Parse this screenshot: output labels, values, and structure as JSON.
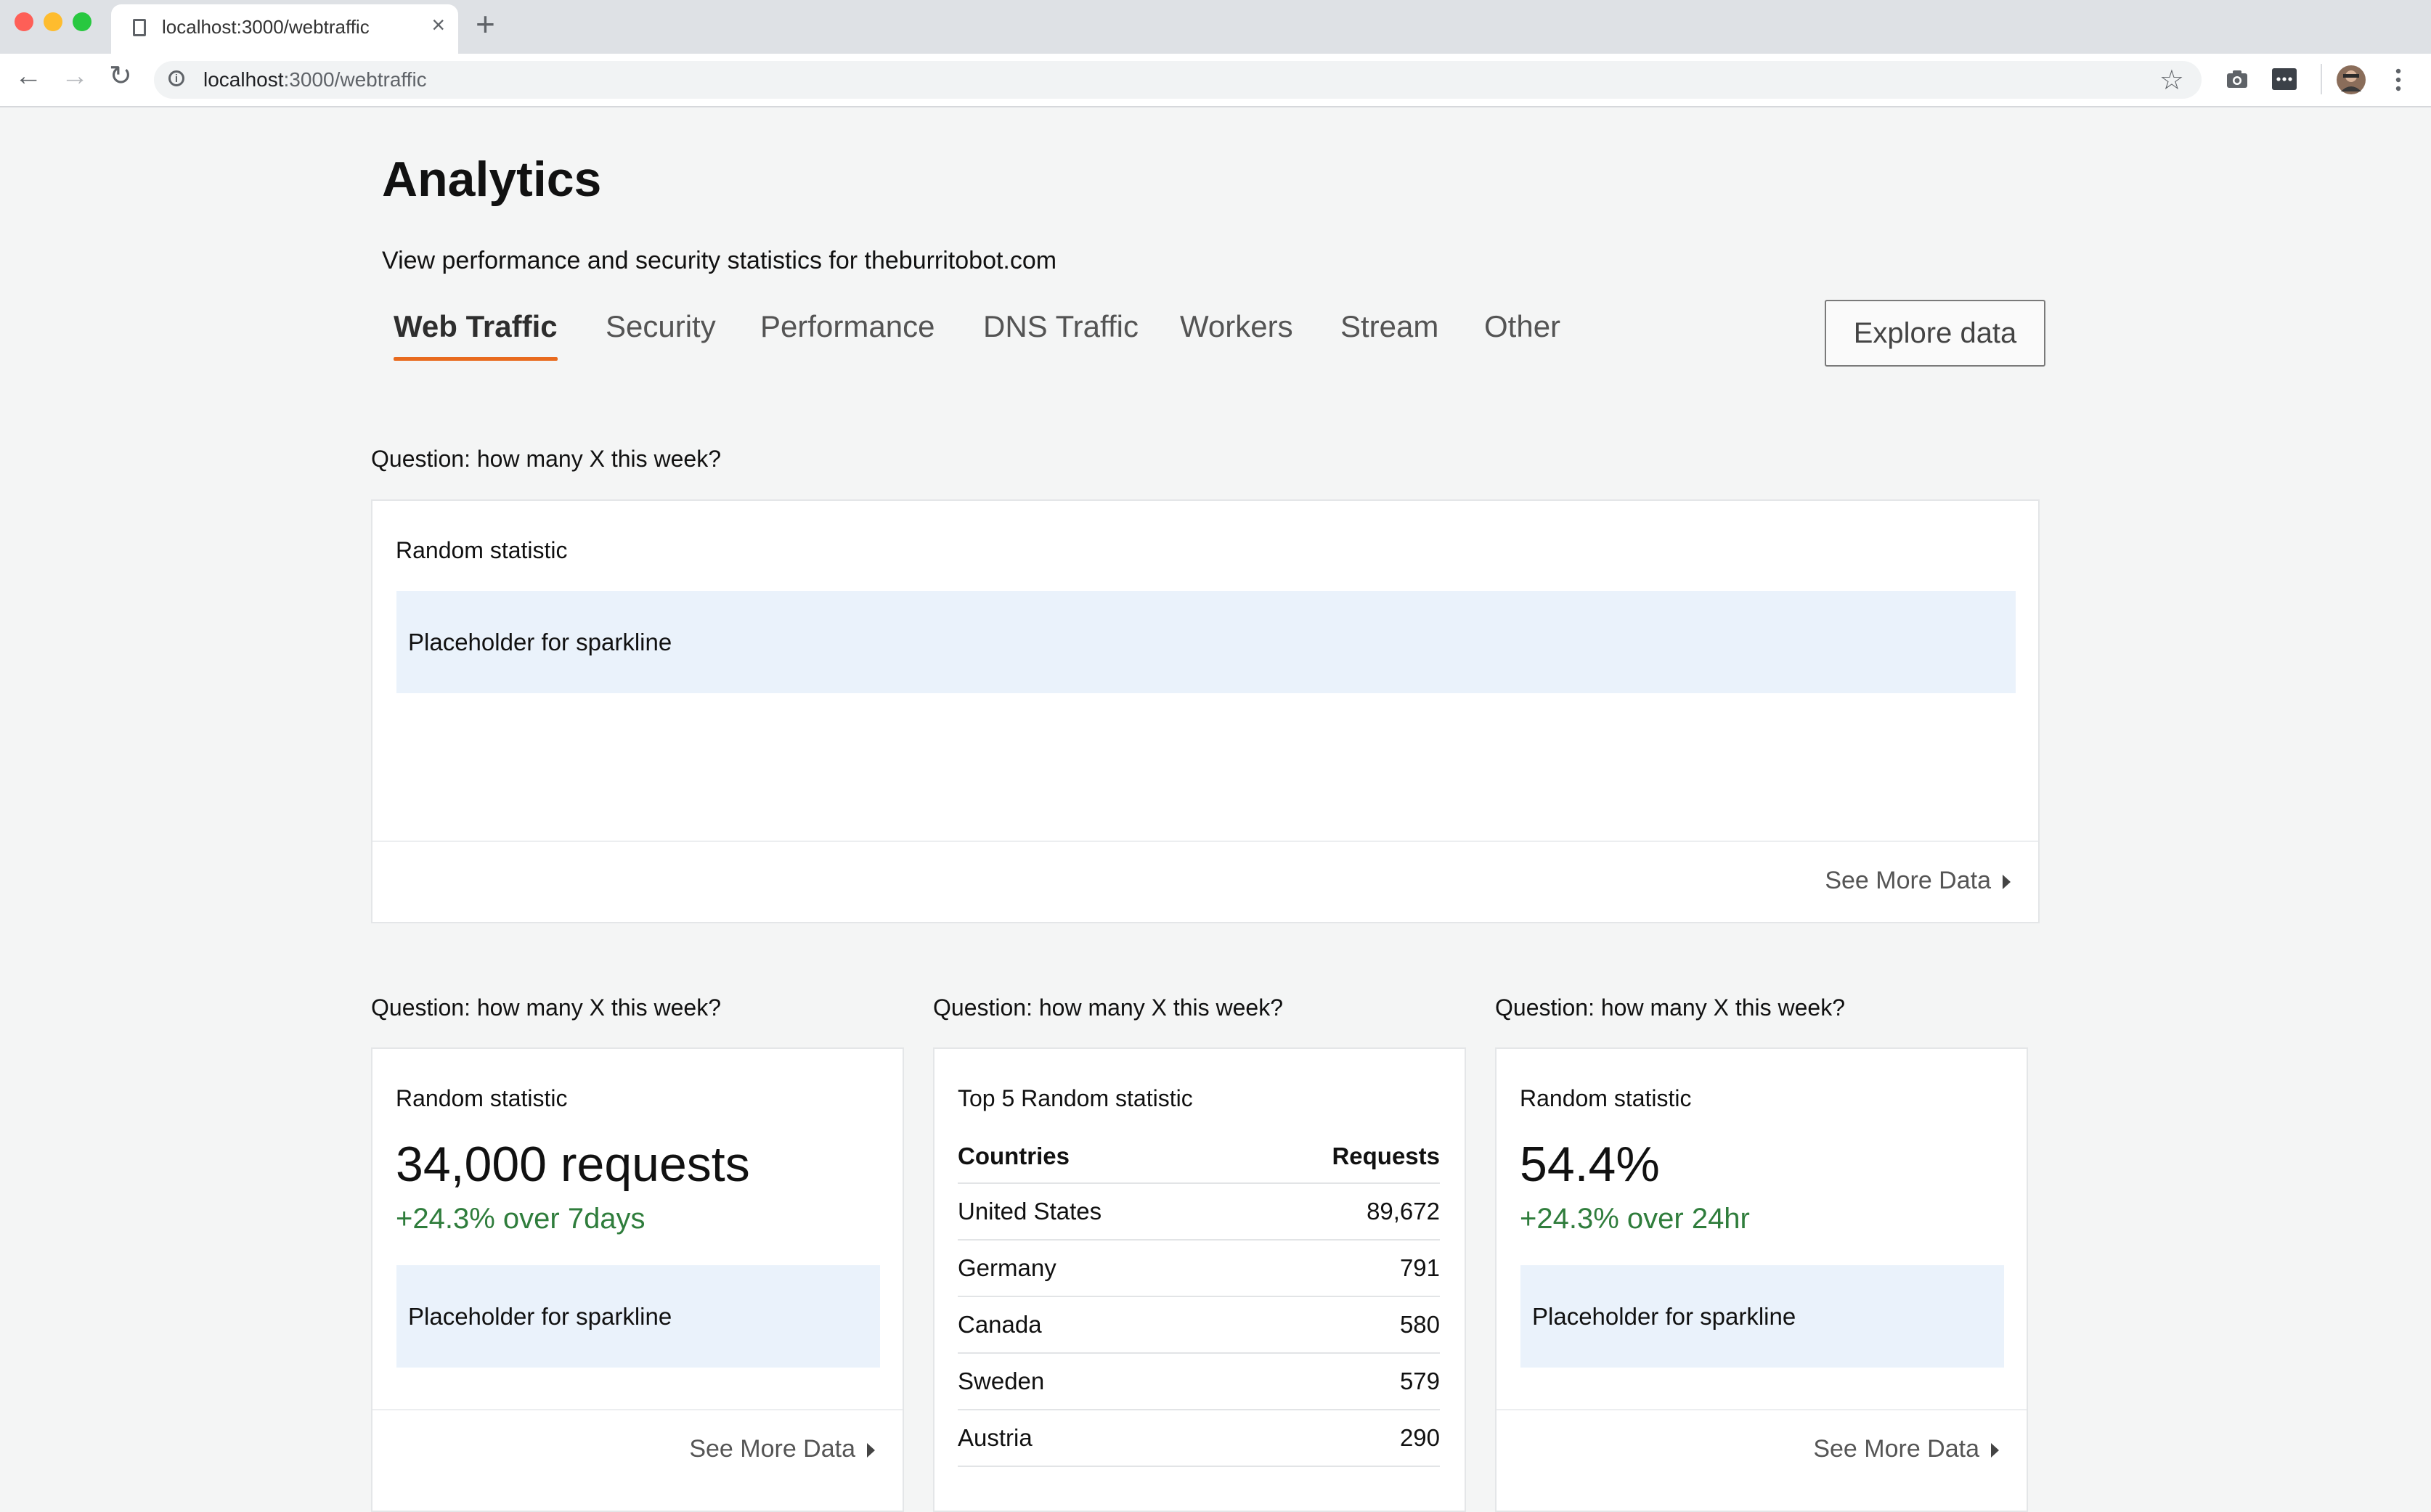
{
  "browser": {
    "tab_title": "localhost:3000/webtraffic",
    "url_host": "localhost",
    "url_path": ":3000/webtraffic",
    "icons": [
      "page-icon",
      "close-icon",
      "plus-icon",
      "back-arrow-icon",
      "forward-arrow-icon",
      "reload-icon",
      "info-icon",
      "star-icon",
      "camera-icon",
      "extension-icon",
      "avatar",
      "kebab-menu-icon"
    ]
  },
  "page": {
    "title": "Analytics",
    "subtitle": "View performance and security statistics for theburritobot.com"
  },
  "nav": {
    "tabs": [
      {
        "label": "Web Traffic",
        "active": true
      },
      {
        "label": "Security",
        "active": false
      },
      {
        "label": "Performance",
        "active": false
      },
      {
        "label": "DNS Traffic",
        "active": false
      },
      {
        "label": "Workers",
        "active": false
      },
      {
        "label": "Stream",
        "active": false
      },
      {
        "label": "Other",
        "active": false
      }
    ],
    "explore_button": "Explore data"
  },
  "colors": {
    "accent": "#e86a1e",
    "positive": "#2f7d3c",
    "placeholder_bg": "#eaf2fb",
    "page_bg": "#f4f5f5"
  },
  "sections": {
    "wide": {
      "question": "Question: how many X this week?",
      "title": "Random statistic",
      "placeholder": "Placeholder for sparkline",
      "see_more": "See More Data"
    },
    "left": {
      "question": "Question: how many X this week?",
      "title": "Random statistic",
      "value": "34,000 requests",
      "delta": "+24.3% over 7days",
      "placeholder": "Placeholder for sparkline",
      "see_more": "See More Data"
    },
    "middle": {
      "question": "Question: how many X this week?",
      "title": "Top 5 Random statistic",
      "columns": [
        "Countries",
        "Requests"
      ],
      "rows": [
        {
          "country": "United States",
          "requests": "89,672"
        },
        {
          "country": "Germany",
          "requests": "791"
        },
        {
          "country": "Canada",
          "requests": "580"
        },
        {
          "country": "Sweden",
          "requests": "579"
        },
        {
          "country": "Austria",
          "requests": "290"
        }
      ]
    },
    "right": {
      "question": "Question: how many X this week?",
      "title": "Random statistic",
      "value": "54.4%",
      "delta": "+24.3% over 24hr",
      "placeholder": "Placeholder for sparkline",
      "see_more": "See More Data"
    }
  }
}
